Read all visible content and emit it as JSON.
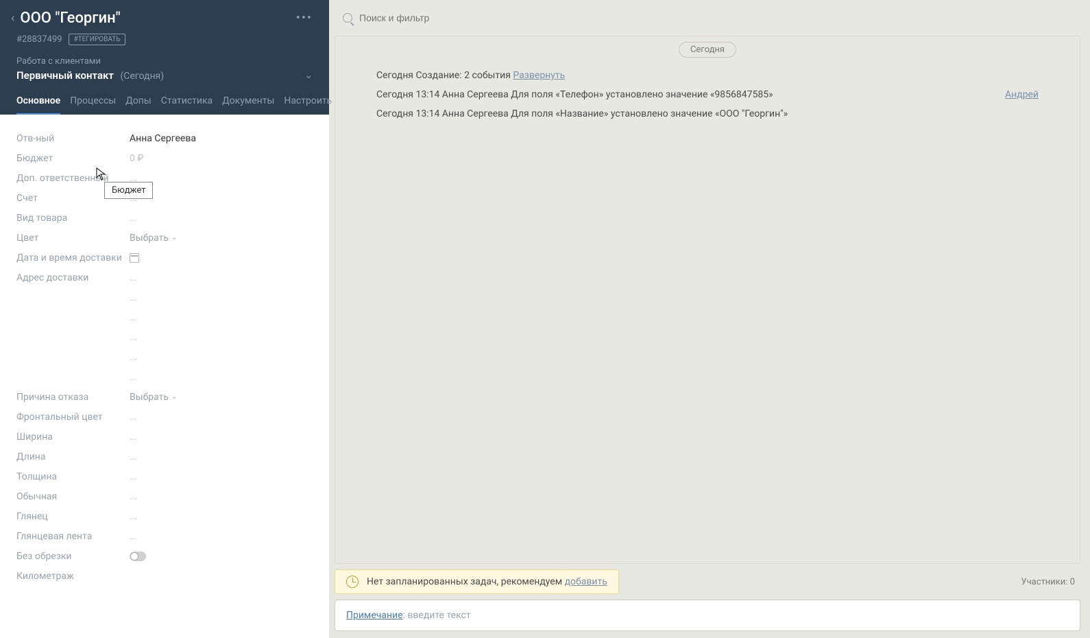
{
  "header": {
    "title": "ООО \"Георгин\"",
    "id": "#28837499",
    "tag_button": "#ТЕГИРОВАТЬ",
    "breadcrumb": "Работа с клиентами",
    "stage": "Первичный контакт",
    "stage_date": "(Сегодня)"
  },
  "tabs": [
    {
      "label": "Основное",
      "active": true
    },
    {
      "label": "Процессы",
      "active": false
    },
    {
      "label": "Допы",
      "active": false
    },
    {
      "label": "Статистика",
      "active": false
    },
    {
      "label": "Документы",
      "active": false
    },
    {
      "label": "Настроить",
      "active": false
    }
  ],
  "fields": {
    "responsible": {
      "label": "Отв-ный",
      "value": "Анна Сергеева"
    },
    "budget": {
      "label": "Бюджет",
      "value": "0 ₽"
    },
    "add_responsible": {
      "label": "Доп. ответственный",
      "value": "..."
    },
    "account": {
      "label": "Счет",
      "value": "..."
    },
    "product_type": {
      "label": "Вид товара",
      "value": "..."
    },
    "color": {
      "label": "Цвет",
      "value": "Выбрать"
    },
    "delivery_datetime": {
      "label": "Дата и время доставки",
      "value": ""
    },
    "delivery_address": {
      "label": "Адрес доставки",
      "value": "..."
    },
    "empty1": {
      "label": "",
      "value": "..."
    },
    "empty2": {
      "label": "",
      "value": "..."
    },
    "empty3": {
      "label": "",
      "value": "..."
    },
    "empty4": {
      "label": "",
      "value": "..."
    },
    "empty5": {
      "label": "",
      "value": "..."
    },
    "refusal_reason": {
      "label": "Причина отказа",
      "value": "Выбрать"
    },
    "front_color": {
      "label": "Фронтальный цвет",
      "value": "..."
    },
    "width": {
      "label": "Ширина",
      "value": "..."
    },
    "length": {
      "label": "Длина",
      "value": "..."
    },
    "thickness": {
      "label": "Толщина",
      "value": "..."
    },
    "regular": {
      "label": "Обычная",
      "value": "..."
    },
    "gloss": {
      "label": "Глянец",
      "value": "..."
    },
    "gloss_tape": {
      "label": "Глянцевая лента",
      "value": "..."
    },
    "no_trim": {
      "label": "Без обрезки",
      "value": ""
    },
    "mileage": {
      "label": "Километраж",
      "value": ""
    }
  },
  "tooltip": "Бюджет",
  "search": {
    "placeholder": "Поиск и фильтр"
  },
  "feed": {
    "date": "Сегодня",
    "lines": [
      {
        "text": "Сегодня Создание: 2 события ",
        "link": "Развернуть",
        "right": ""
      },
      {
        "text": "Сегодня 13:14 Анна Сергеева Для поля «Телефон» установлено значение «9856847585»",
        "link": "",
        "right": "Андрей"
      },
      {
        "text": "Сегодня 13:14 Анна Сергеева Для поля «Название» установлено значение «ООО \"Георгин\"»",
        "link": "",
        "right": ""
      }
    ]
  },
  "task_banner": {
    "text": "Нет запланированных задач, рекомендуем ",
    "link": "добавить"
  },
  "participants": "Участники: 0",
  "note": {
    "link": "Примечание",
    "placeholder": ": введите текст"
  }
}
